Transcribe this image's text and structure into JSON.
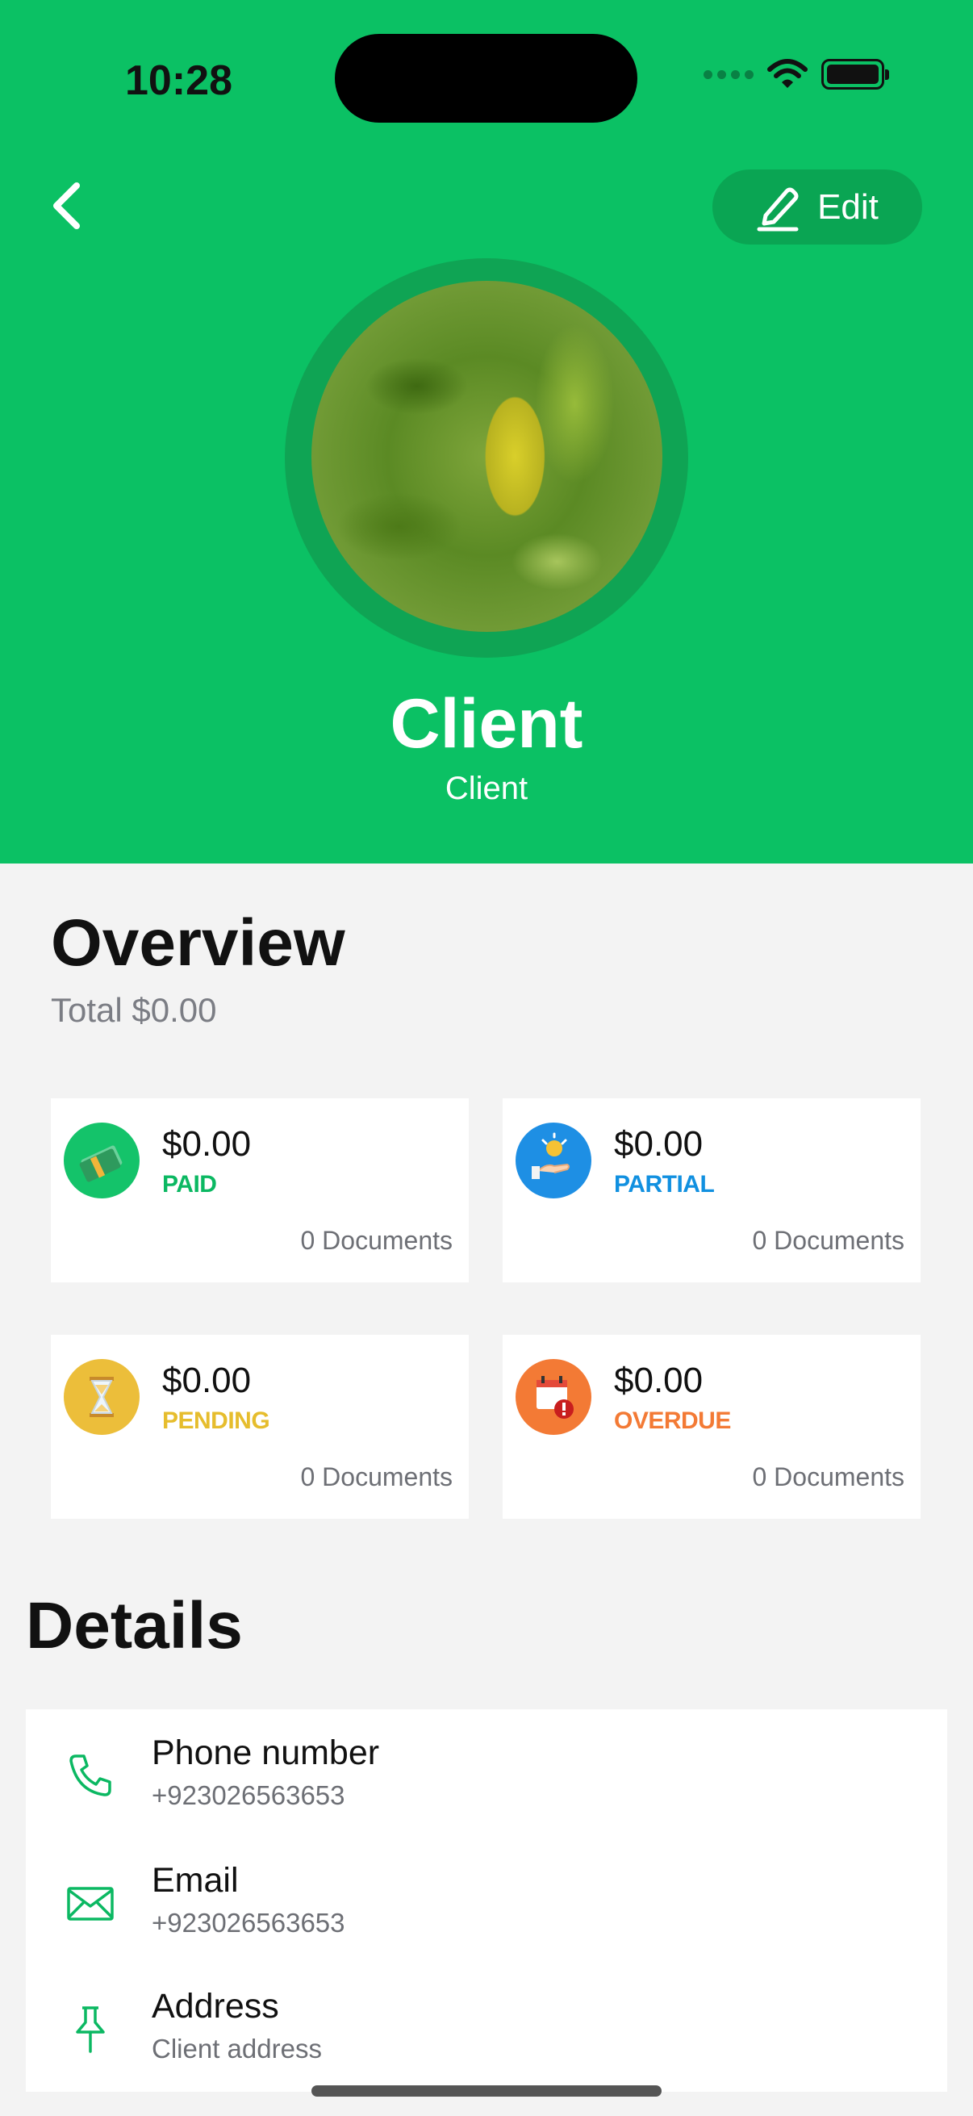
{
  "status_bar": {
    "time": "10:28"
  },
  "header": {
    "edit_label": "Edit",
    "name": "Client",
    "role": "Client"
  },
  "overview": {
    "title": "Overview",
    "total": "Total $0.00",
    "cards": [
      {
        "amount": "$0.00",
        "label": "PAID",
        "docs": "0 Documents",
        "color": "#0bb862"
      },
      {
        "amount": "$0.00",
        "label": "PARTIAL",
        "docs": "0 Documents",
        "color": "#1190e0"
      },
      {
        "amount": "$0.00",
        "label": "PENDING",
        "docs": "0 Documents",
        "color": "#e6bd2d"
      },
      {
        "amount": "$0.00",
        "label": "OVERDUE",
        "docs": "0 Documents",
        "color": "#f37a35"
      }
    ]
  },
  "details": {
    "title": "Details",
    "rows": [
      {
        "title": "Phone number",
        "value": "+923026563653",
        "icon": "phone-icon"
      },
      {
        "title": "Email",
        "value": "+923026563653",
        "icon": "envelope-icon"
      },
      {
        "title": "Address",
        "value": "Client address",
        "icon": "pin-icon"
      }
    ]
  },
  "colors": {
    "brand_green": "#0bc164",
    "accent_green": "#0aa553",
    "background": "#f3f3f3"
  }
}
